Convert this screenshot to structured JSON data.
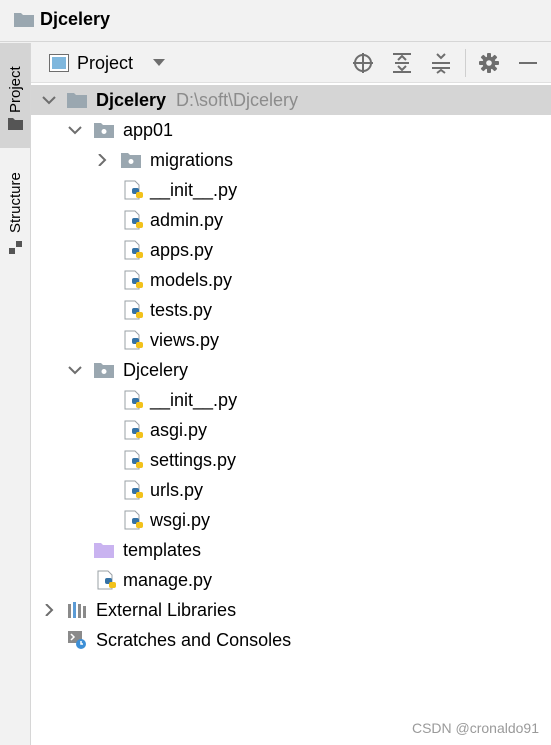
{
  "window": {
    "title": "Djcelery"
  },
  "side_tabs": [
    {
      "label": "Project"
    },
    {
      "label": "Structure"
    }
  ],
  "toolbar": {
    "view_label": "Project",
    "buttons": [
      "locate-icon",
      "expand-all-icon",
      "collapse-all-icon",
      "gear-icon",
      "minimize-icon"
    ]
  },
  "tree": {
    "root": {
      "name": "Djcelery",
      "path": "D:\\soft\\Djcelery"
    },
    "app01": {
      "name": "app01",
      "migrations": "migrations",
      "files": [
        "__init__.py",
        "admin.py",
        "apps.py",
        "models.py",
        "tests.py",
        "views.py"
      ]
    },
    "djcelery": {
      "name": "Djcelery",
      "files": [
        "__init__.py",
        "asgi.py",
        "settings.py",
        "urls.py",
        "wsgi.py"
      ]
    },
    "templates": "templates",
    "manage": "manage.py",
    "external_libraries": "External Libraries",
    "scratches": "Scratches and Consoles"
  },
  "watermark": "CSDN @cronaldo91",
  "colors": {
    "folder": "#9aa7b0",
    "templates_folder": "#c9b3f0",
    "python_blue": "#3572a5",
    "python_yellow": "#f2c21b",
    "selection": "#d5d5d5"
  }
}
